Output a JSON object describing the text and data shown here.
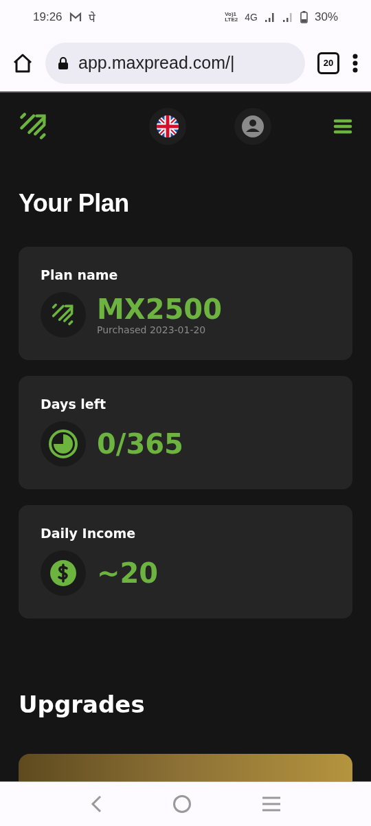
{
  "status_bar": {
    "time": "19:26",
    "notification": "पे",
    "volte_top": "Vo)1",
    "volte_bottom": "LTE2",
    "network": "4G",
    "battery": "30%"
  },
  "browser": {
    "url": "app.maxpread.com/|",
    "tab_count": "20"
  },
  "page_title": "Your Plan",
  "cards": [
    {
      "kind": "logo",
      "label": "Plan name",
      "value": "MX2500",
      "note": "Purchased 2023-01-20"
    },
    {
      "kind": "pie",
      "label": "Days left",
      "value": "0/365"
    },
    {
      "kind": "dollar",
      "label": "Daily Income",
      "value": "~20"
    }
  ],
  "section_title": "Upgrades"
}
